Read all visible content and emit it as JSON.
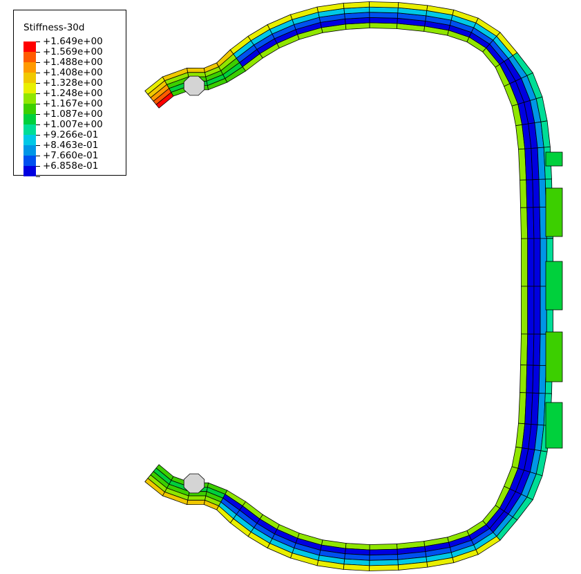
{
  "legend": {
    "title": "Stiffness-30d",
    "levels": [
      {
        "label": "+1.649e+00",
        "color": "#ff0000"
      },
      {
        "label": "+1.569e+00",
        "color": "#ff5a00"
      },
      {
        "label": "+1.488e+00",
        "color": "#ff9a00"
      },
      {
        "label": "+1.408e+00",
        "color": "#f0c800"
      },
      {
        "label": "+1.328e+00",
        "color": "#e8ef00"
      },
      {
        "label": "+1.248e+00",
        "color": "#90e600"
      },
      {
        "label": "+1.167e+00",
        "color": "#3ccf00"
      },
      {
        "label": "+1.087e+00",
        "color": "#00d03c"
      },
      {
        "label": "+1.007e+00",
        "color": "#00dd96"
      },
      {
        "label": "+9.266e-01",
        "color": "#00c8e6"
      },
      {
        "label": "+8.463e-01",
        "color": "#0096e6"
      },
      {
        "label": "+7.660e-01",
        "color": "#0050ef"
      },
      {
        "label": "+6.858e-01",
        "color": "#0000e0"
      }
    ]
  },
  "bead_color": "#d4d4d4"
}
